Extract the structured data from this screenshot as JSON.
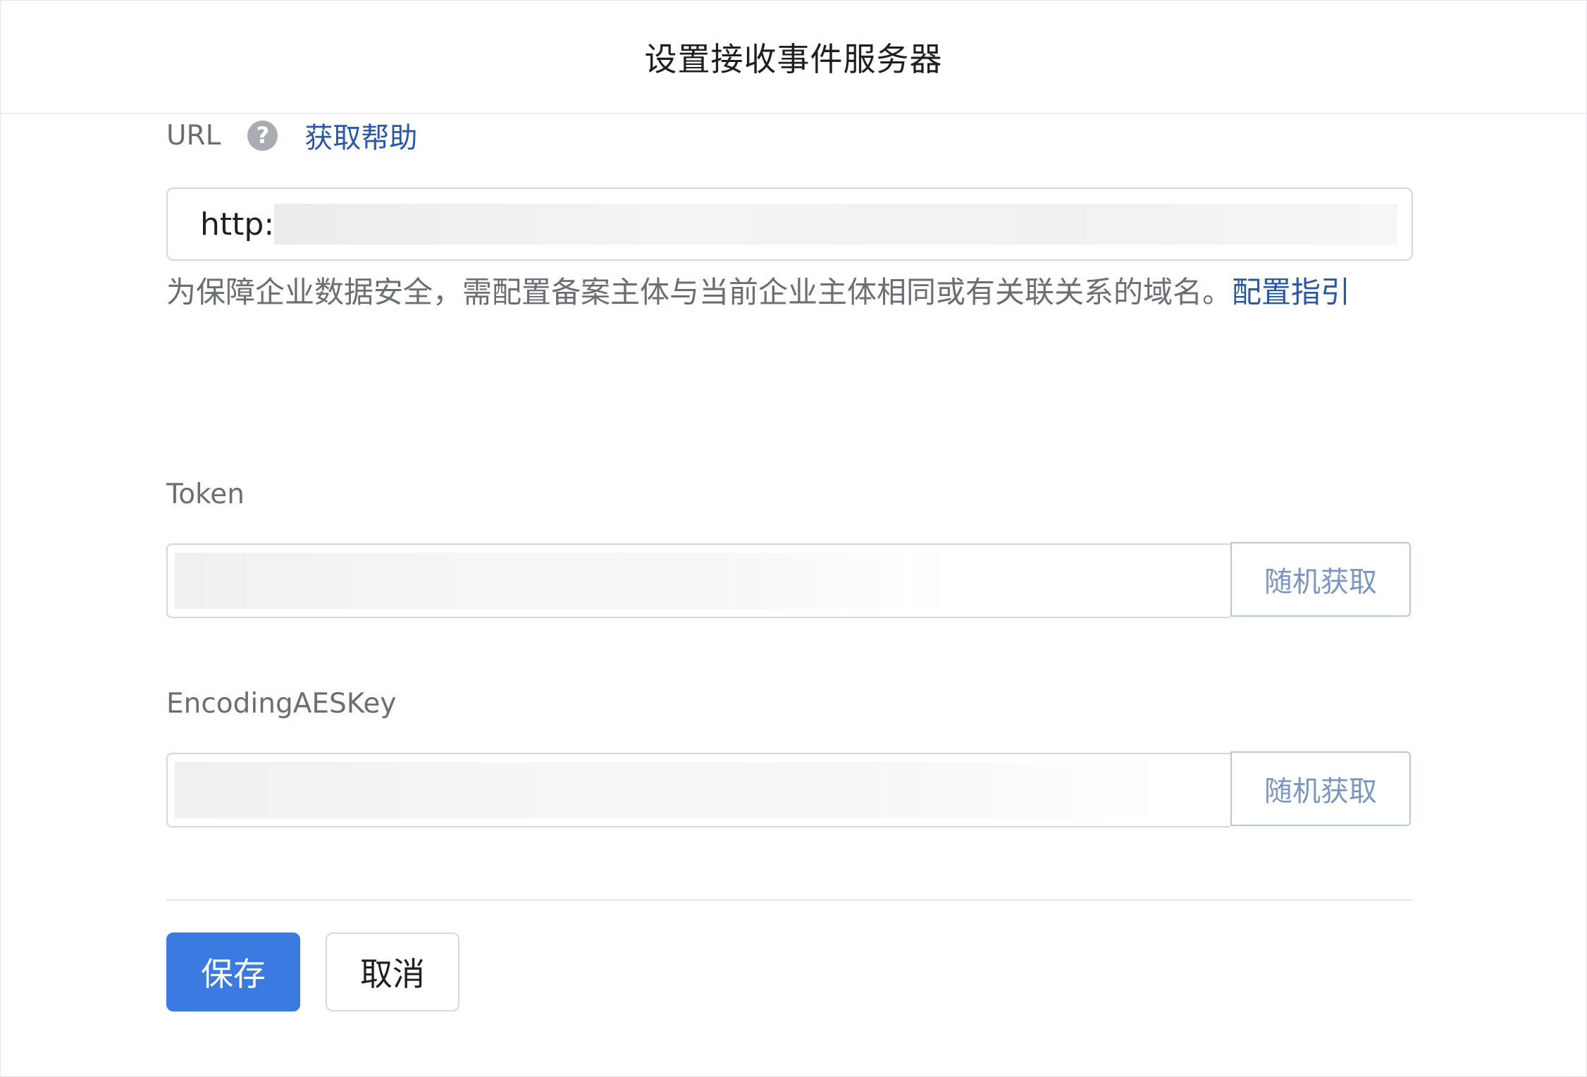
{
  "dialog": {
    "title": "设置接收事件服务器"
  },
  "url_field": {
    "label": "URL",
    "help_icon": "question-circle-icon",
    "help_link": "获取帮助",
    "value_prefix": "http:",
    "hint_text": "为保障企业数据安全，需配置备案主体与当前企业主体相同或有关联关系的域名。",
    "hint_link": "配置指引"
  },
  "token_field": {
    "label": "Token",
    "button_label": "随机获取"
  },
  "aes_field": {
    "label": "EncodingAESKey",
    "button_label": "随机获取"
  },
  "actions": {
    "save_label": "保存",
    "cancel_label": "取消"
  },
  "colors": {
    "primary": "#3b7be1",
    "link": "#2a58a8",
    "secondary_button_text": "#7d96bf"
  }
}
